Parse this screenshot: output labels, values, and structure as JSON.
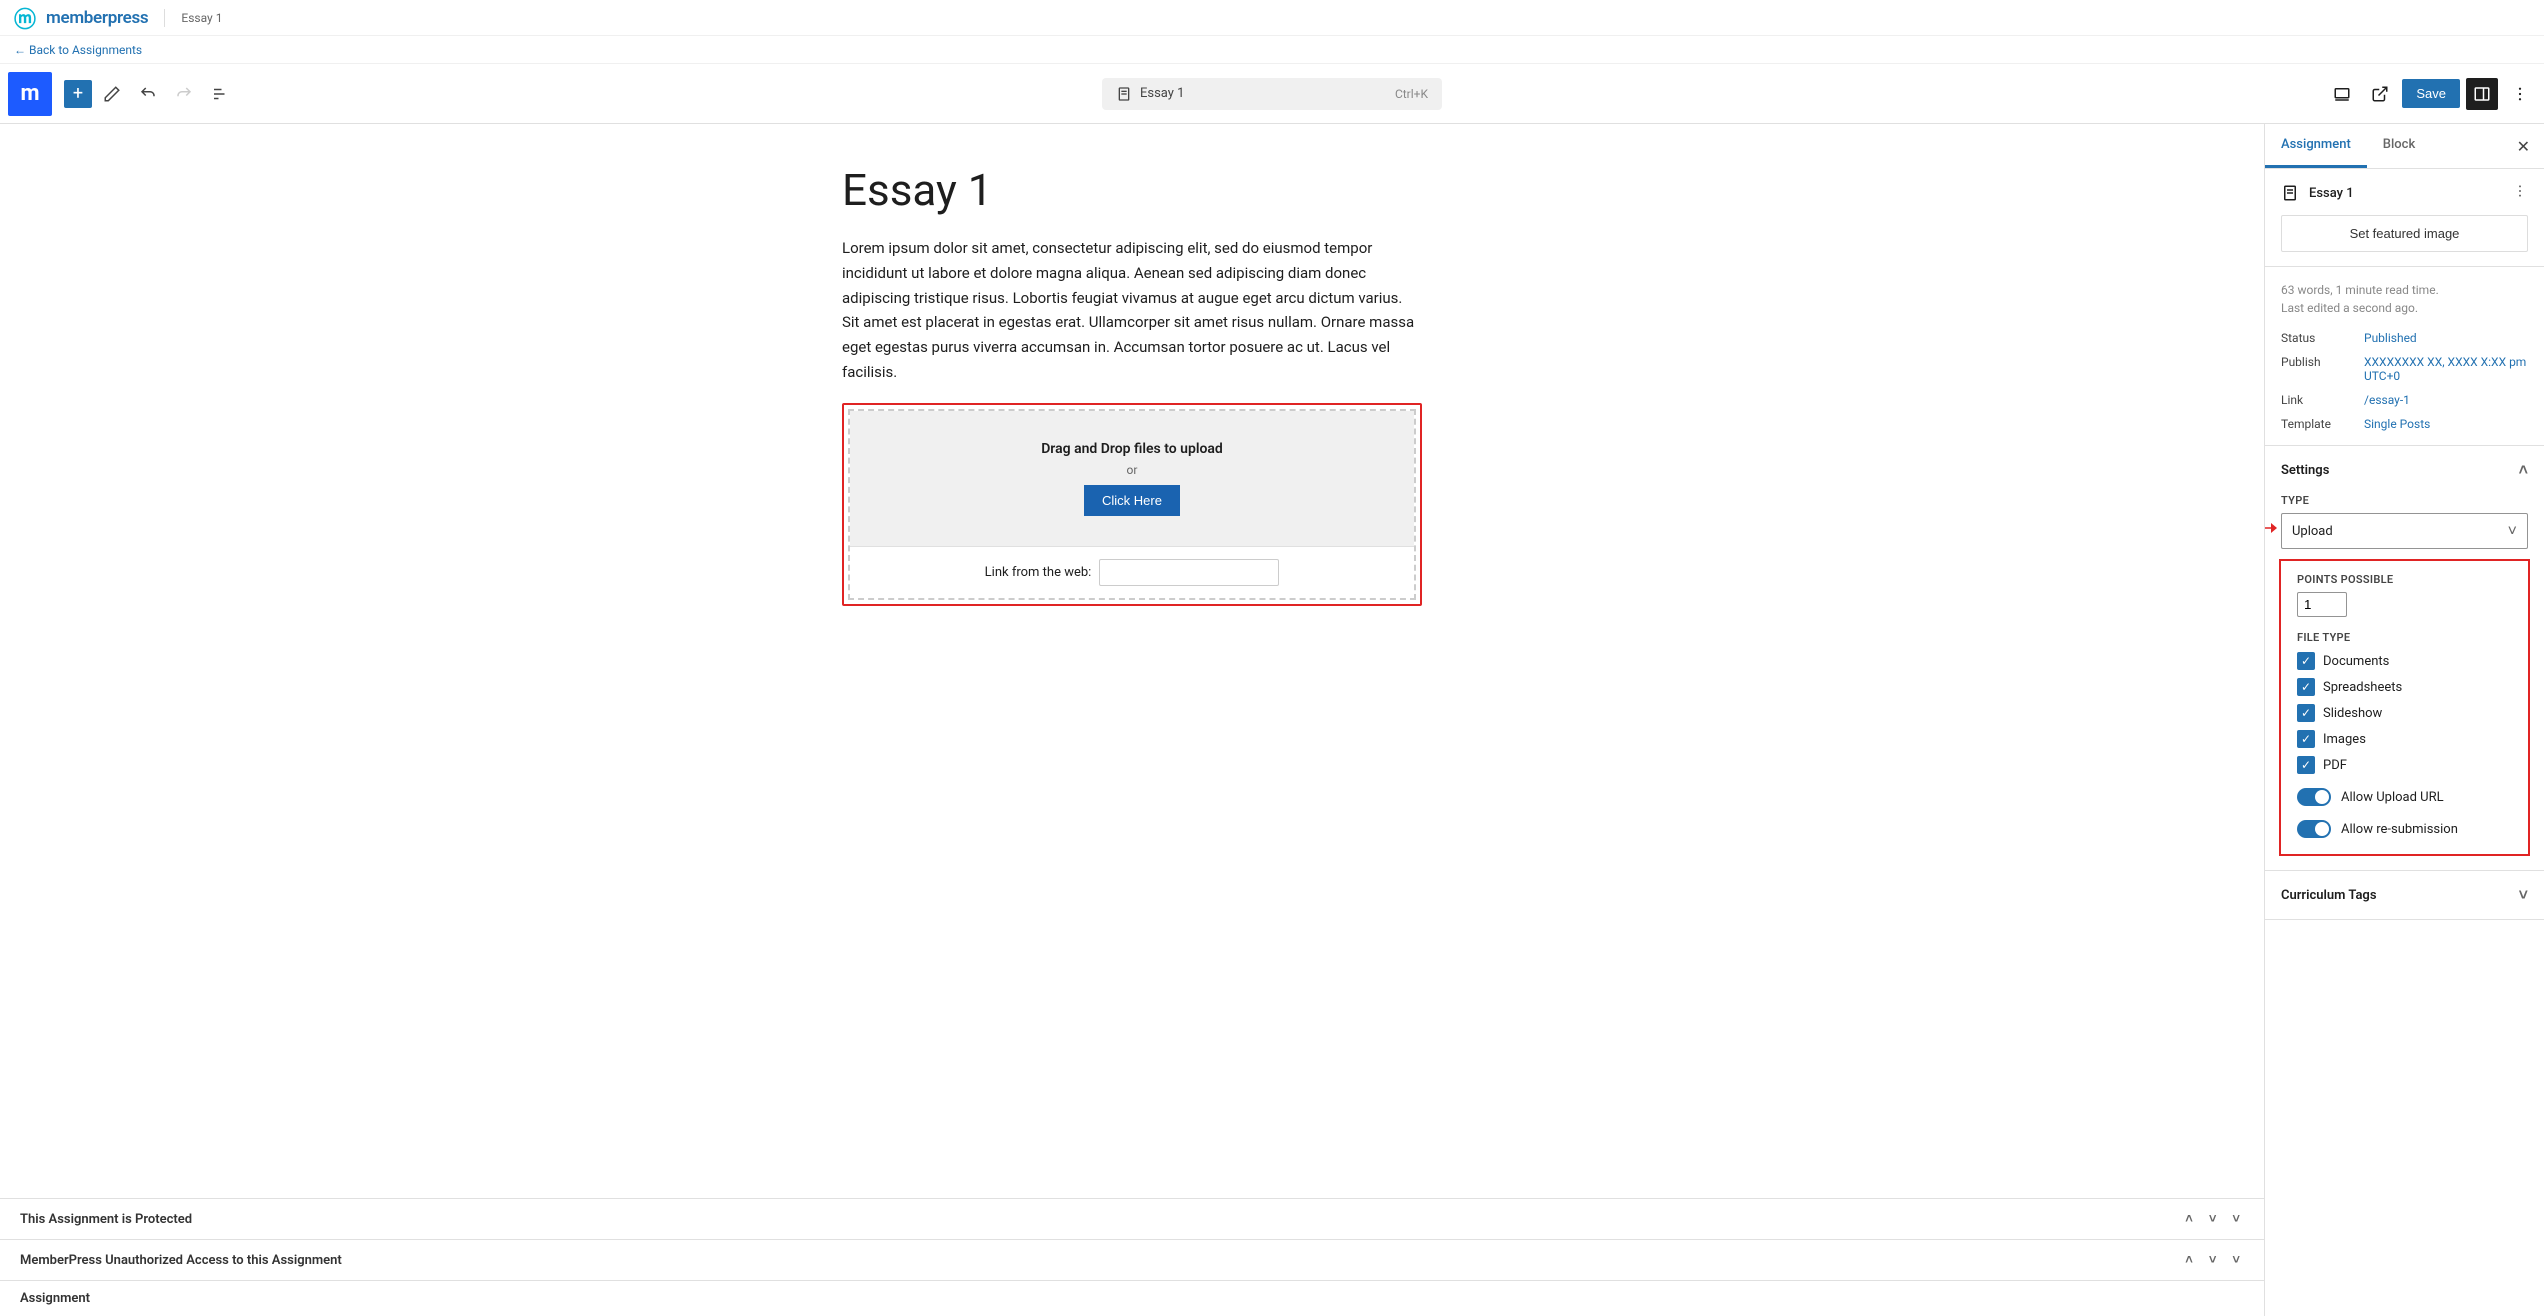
{
  "brand": {
    "name": "memberpress",
    "crumb": "Essay 1"
  },
  "back_link": "← Back to Assignments",
  "toolbar": {
    "title": "Essay 1",
    "shortcut": "Ctrl+K",
    "save": "Save"
  },
  "doc": {
    "title": "Essay 1",
    "body": "Lorem ipsum dolor sit amet, consectetur adipiscing elit, sed do eiusmod tempor incididunt ut labore et dolore magna aliqua. Aenean sed adipiscing diam donec adipiscing tristique risus. Lobortis feugiat vivamus at augue eget arcu dictum varius. Sit amet est placerat in egestas erat. Ullamcorper sit amet risus nullam. Ornare massa eget egestas purus viverra accumsan in. Accumsan tortor posuere ac ut. Lacus vel facilisis.",
    "upload": {
      "drag_title": "Drag and Drop files to upload",
      "or": "or",
      "click_here": "Click Here",
      "link_label": "Link from the web:"
    }
  },
  "panels": {
    "p1": "This Assignment is Protected",
    "p2": "MemberPress Unauthorized Access to this Assignment",
    "p3": "Assignment"
  },
  "sidebar": {
    "tabs": {
      "assignment": "Assignment",
      "block": "Block"
    },
    "doc_title": "Essay 1",
    "featured": "Set featured image",
    "words": "63 words, 1 minute read time.",
    "edited": "Last edited a second ago.",
    "meta": {
      "status_l": "Status",
      "status_v": "Published",
      "publish_l": "Publish",
      "publish_v": "XXXXXXXX XX, XXXX X:XX pm UTC+0",
      "link_l": "Link",
      "link_v": "/essay-1",
      "template_l": "Template",
      "template_v": "Single Posts"
    },
    "settings": {
      "header": "Settings",
      "type_label": "TYPE",
      "type_value": "Upload",
      "points_label": "POINTS POSSIBLE",
      "points_value": "1",
      "filetype_label": "FILE TYPE",
      "ft": {
        "documents": "Documents",
        "spreadsheets": "Spreadsheets",
        "slideshow": "Slideshow",
        "images": "Images",
        "pdf": "PDF"
      },
      "allow_url": "Allow Upload URL",
      "allow_resub": "Allow re-submission"
    },
    "curriculum": "Curriculum Tags"
  }
}
